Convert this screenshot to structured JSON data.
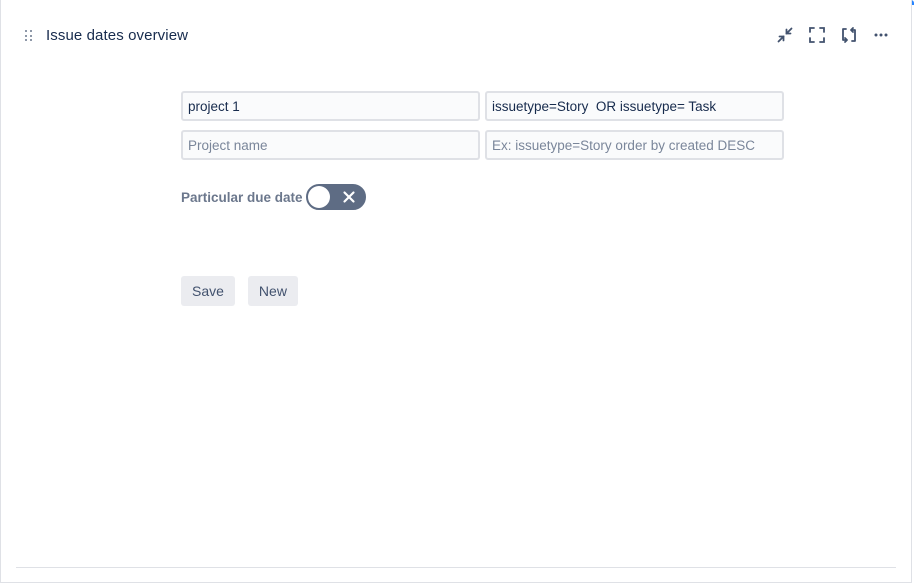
{
  "gadget": {
    "title": "Issue dates overview"
  },
  "header_actions": [
    {
      "icon": "minimize-icon"
    },
    {
      "icon": "fullscreen-icon"
    },
    {
      "icon": "refresh-icon"
    },
    {
      "icon": "more-icon"
    }
  ],
  "form": {
    "row1": {
      "project_value": "project 1",
      "jql_value": "issuetype=Story  OR issuetype= Task"
    },
    "row2": {
      "project_placeholder": "Project name",
      "jql_placeholder": "Ex: issuetype=Story order by created DESC"
    },
    "toggle": {
      "label": "Particular due date",
      "checked": false
    },
    "buttons": {
      "save_label": "Save",
      "new_label": "New"
    }
  },
  "colors": {
    "accent": "#2684ff",
    "toggle_off": "#5e6c84",
    "button_bg": "#ebecf0"
  }
}
